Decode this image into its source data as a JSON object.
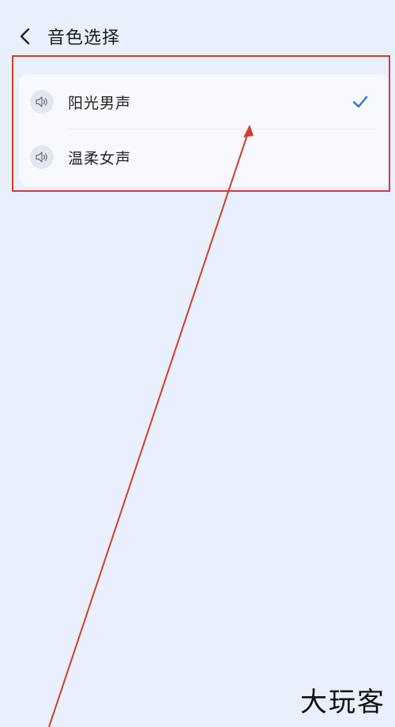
{
  "header": {
    "title": "音色选择",
    "back_icon": "chevron-left-icon"
  },
  "voice_options": [
    {
      "label": "阳光男声",
      "icon": "speaker-icon",
      "selected": true
    },
    {
      "label": "温柔女声",
      "icon": "speaker-icon",
      "selected": false
    }
  ],
  "colors": {
    "background": "#e7f0fc",
    "card": "#f7f9fe",
    "check": "#3b82c4",
    "annotation": "#d63b2f"
  },
  "watermark": "大玩客"
}
